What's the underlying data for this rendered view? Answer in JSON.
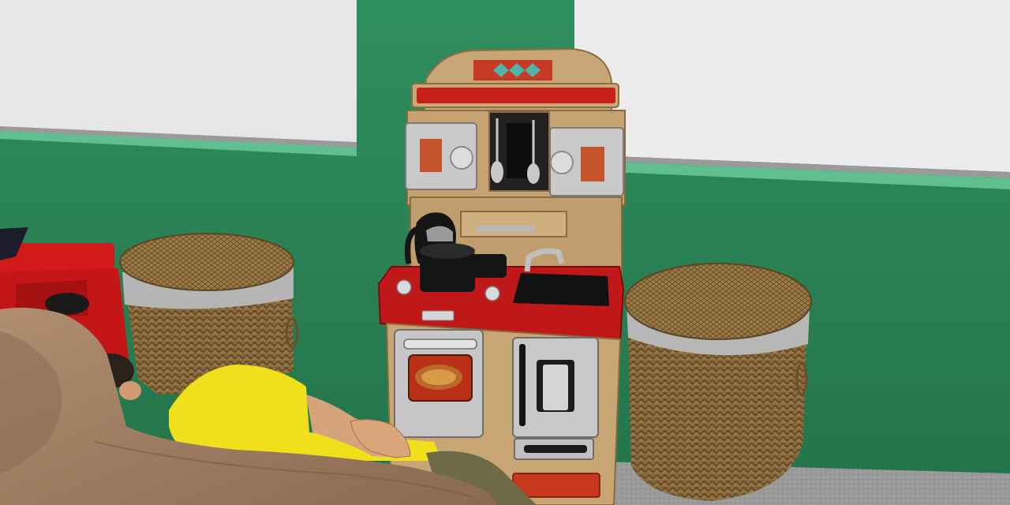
{
  "scene": {
    "description_hint": "",
    "colors": {
      "wall_green": "#2e8a5c",
      "wall_green_dark": "#216b46",
      "trim_light": "#5fbf8f",
      "window_panel": "#e9e9e9",
      "floor": "#9a9a9a",
      "wicker": "#8a6a3c",
      "wicker_dark": "#5c4426",
      "band_grey": "#b9b9b9",
      "kitchen_wood": "#c9a877",
      "kitchen_red": "#c01818",
      "kitchen_black": "#151515",
      "shirt_yellow": "#f2e21c",
      "dog_brown": "#a07f63",
      "skin": "#d9a07a"
    },
    "objects": [
      {
        "name": "left-window-panel",
        "icon": "window"
      },
      {
        "name": "right-window-panel",
        "icon": "window"
      },
      {
        "name": "toy-kitchen",
        "icon": "play-kitchen"
      },
      {
        "name": "left-wicker-basket",
        "icon": "laundry-basket"
      },
      {
        "name": "right-wicker-basket",
        "icon": "laundry-basket"
      },
      {
        "name": "red-toy-chair",
        "icon": "toy-chair"
      },
      {
        "name": "person-yellow-shirt",
        "icon": "person"
      },
      {
        "name": "dog",
        "icon": "dog"
      }
    ]
  }
}
